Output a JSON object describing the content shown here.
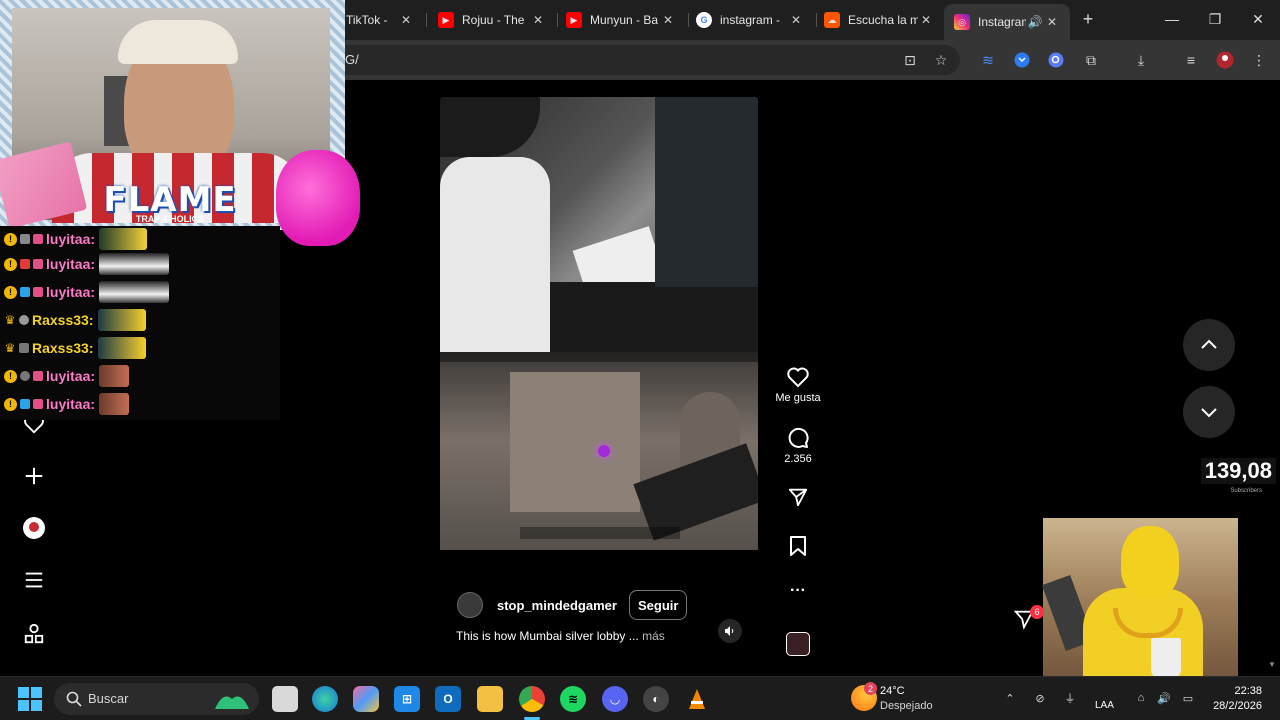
{
  "browser": {
    "tabs": [
      {
        "title": "TikTok -",
        "favicon": "tiktok-icon",
        "color": "#111111"
      },
      {
        "title": "Rojuu - The",
        "favicon": "youtube-icon",
        "color": "#ff0000"
      },
      {
        "title": "Munyun - Ba",
        "favicon": "youtube-icon",
        "color": "#ff0000"
      },
      {
        "title": "instagram -",
        "favicon": "google-icon",
        "color": "#ffffff"
      },
      {
        "title": "Escucha la m",
        "favicon": "soundcloud-icon",
        "color": "#ff5500"
      },
      {
        "title": "Instagram",
        "favicon": "instagram-icon",
        "color": "#e1306c",
        "active": true
      }
    ],
    "url": "G/",
    "new_tab": "+",
    "window_controls": {
      "minimize": "—",
      "maximize": "❐",
      "close": "✕"
    }
  },
  "webcam_overlay": {
    "logo": "FLAME",
    "logo_sub": "TRAP 4 HOLICS"
  },
  "chat": {
    "messages": [
      {
        "user": "luyitaa:",
        "color": "pink",
        "badge": "gold"
      },
      {
        "user": "luyitaa:",
        "color": "pink",
        "badge": "gold"
      },
      {
        "user": "luyitaa:",
        "color": "pink",
        "badge": "gold"
      },
      {
        "user": "Raxss33:",
        "color": "yellow",
        "badge": "crown"
      },
      {
        "user": "Raxss33:",
        "color": "yellow",
        "badge": "crown"
      },
      {
        "user": "luyitaa:",
        "color": "pink",
        "badge": "gold"
      },
      {
        "user": "luyitaa:",
        "color": "pink",
        "badge": "gold"
      }
    ]
  },
  "left_nav": {
    "icons": [
      "heart-icon",
      "create-icon",
      "profile-icon",
      "menu-icon",
      "apps-icon"
    ]
  },
  "reel": {
    "sub_counter": "139,08",
    "sub_counter_caption": "Subscribers",
    "username": "stop_mindedgamer",
    "follow_label": "Seguir",
    "caption": "This is how Mumbai silver lobby ...",
    "more_label": "más"
  },
  "actions": {
    "like_label": "Me gusta",
    "comments_count": "2.356"
  },
  "floating": {
    "notification_count": "6"
  },
  "taskbar": {
    "search_placeholder": "Buscar",
    "weather_badge": "2",
    "temperature": "24°C",
    "condition": "Despejado",
    "language": "LAA",
    "time": "22:38",
    "date": "28/2/2026"
  }
}
